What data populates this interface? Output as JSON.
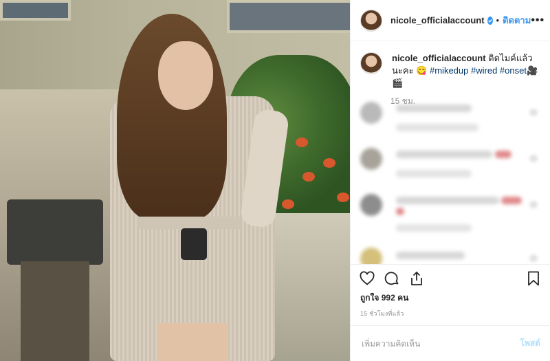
{
  "header": {
    "username": "nicole_officialaccount",
    "separator": "•",
    "follow_label": "ติดตาม",
    "more_label": "•••"
  },
  "caption": {
    "username": "nicole_officialaccount",
    "text": "ติดไมค์แล้วนะคะ",
    "emoji": "😋",
    "hashtags": [
      "#mikedup",
      "#wired",
      "#onset"
    ],
    "trailing_emoji": "🎥🎬",
    "time": "15 ชม."
  },
  "actions": {
    "like_icon": "heart-icon",
    "comment_icon": "comment-icon",
    "share_icon": "share-icon",
    "save_icon": "bookmark-icon"
  },
  "likes_text": "ถูกใจ 992 คน",
  "posted_time": "15 ชั่วโมงที่แล้ว",
  "comment_box": {
    "placeholder": "เพิ่มความคิดเห็น",
    "post_label": "โพสต์"
  },
  "colors": {
    "accent": "#3897f0",
    "text": "#262626",
    "muted": "#8e8e8e",
    "hashtag": "#003569",
    "post_disabled": "#b2dffc"
  }
}
